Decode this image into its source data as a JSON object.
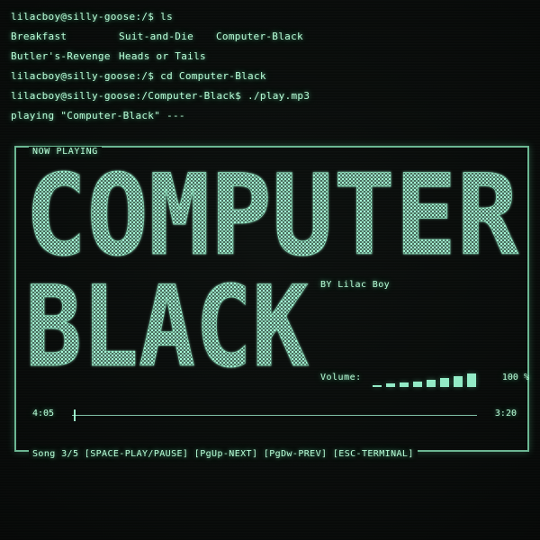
{
  "terminal": {
    "lines": [
      {
        "kind": "cmd",
        "text": "lilacboy@silly-goose:/$ ls"
      },
      {
        "kind": "cols",
        "items": [
          "Breakfast",
          "Suit-and-Die",
          "Computer-Black"
        ]
      },
      {
        "kind": "cols",
        "items": [
          "Butler's-Revenge",
          "Heads or Tails",
          ""
        ]
      },
      {
        "kind": "cmd",
        "text": "lilacboy@silly-goose:/$ cd Computer-Black"
      },
      {
        "kind": "cmd",
        "text": "lilacboy@silly-goose:/Computer-Black$ ./play.mp3"
      },
      {
        "kind": "cmd",
        "text": "playing \"Computer-Black\" ---"
      }
    ]
  },
  "player": {
    "header": "NOW PLAYING",
    "title_line_1": "COMPUTER",
    "title_line_2": "BLACK",
    "artist": "BY Lilac Boy",
    "volume": {
      "label": "Volume:",
      "percent": "100 %",
      "levels": [
        0.12,
        0.2,
        0.28,
        0.36,
        0.44,
        0.56,
        0.68,
        0.84
      ]
    },
    "timeline": {
      "elapsed": "4:05",
      "total": "3:20",
      "progress": 0.005
    },
    "controls_hint": "Song 3/5 [SPACE-PLAY/PAUSE] [PgUp-NEXT] [PgDw-PREV] [ESC-TERMINAL]"
  },
  "colors": {
    "phosphor": "#b9ffd9",
    "background": "#0b0f0d"
  }
}
